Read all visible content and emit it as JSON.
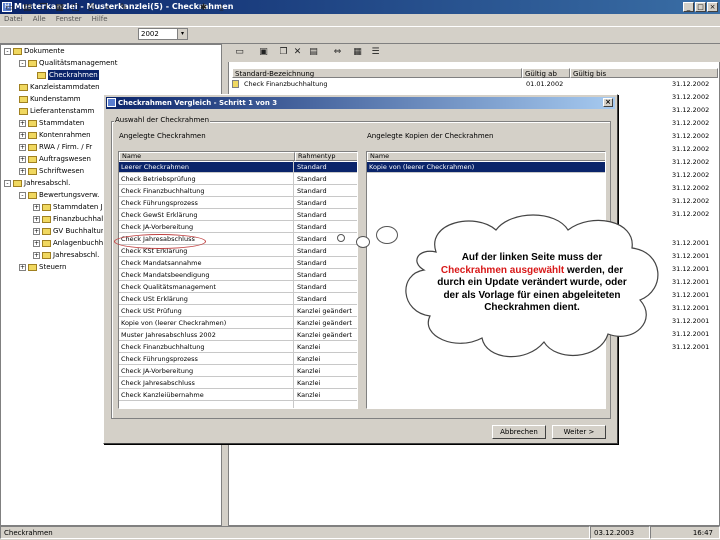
{
  "window": {
    "title": "Musterkanzlei - Musterkanzlei(5) - Checkrahmen",
    "app_icon": "app-icon",
    "controls": [
      "_",
      "□",
      "×"
    ]
  },
  "menu": [
    "Datei",
    "Alle",
    "Fenster",
    "Hilfe"
  ],
  "toolbar": {
    "year": "2002",
    "dropdown_glyph": "▾"
  },
  "tree": [
    {
      "label": "Dokumente",
      "expander": "-"
    },
    {
      "label": "Qualitätsmanagement",
      "expander": "-"
    },
    {
      "label": "Checkrahmen",
      "selected": true
    },
    {
      "label": "Kanzleistammdaten"
    },
    {
      "label": "Kundenstamm"
    },
    {
      "label": "Lieferantenstamm"
    },
    {
      "label": "Stammdaten",
      "expander": "+"
    },
    {
      "label": "Kontenrahmen",
      "expander": "+"
    },
    {
      "label": "RWA / Firm. / Fr",
      "expander": "+"
    },
    {
      "label": "Auftragswesen",
      "expander": "+"
    },
    {
      "label": "Schriftwesen",
      "expander": "+"
    },
    {
      "label": "Jahresabschl.",
      "expander": "-"
    },
    {
      "label": "Bewertungsverw.",
      "expander": "-"
    },
    {
      "label": "Stammdaten J.",
      "expander": "+"
    },
    {
      "label": "Finanzbuchhaltung",
      "expander": "+"
    },
    {
      "label": "GV Buchhaltung",
      "expander": "+"
    },
    {
      "label": "Anlagenbuchhaltung",
      "expander": "+"
    },
    {
      "label": "Jahresabschl.",
      "expander": "+"
    },
    {
      "label": "Steuern",
      "expander": "+"
    }
  ],
  "grid": {
    "columns": [
      "Standard-Bezeichnung",
      "Gültig ab",
      "Gültig bis"
    ],
    "first_row": {
      "name": "Check Finanzbuchhaltung",
      "from": "01.01.2002"
    },
    "dates": [
      "31.12.2002",
      "31.12.2002",
      "31.12.2002",
      "31.12.2002",
      "31.12.2002",
      "31.12.2002",
      "31.12.2002",
      "31.12.2002",
      "31.12.2002",
      "31.12.2002",
      "31.12.2002",
      "31.12.2001",
      "31.12.2001",
      "31.12.2001",
      "31.12.2001",
      "31.12.2001",
      "31.12.2001",
      "31.12.2001",
      "31.12.2001",
      "31.12.2001"
    ]
  },
  "status": {
    "left": "Checkrahmen",
    "date": "03.12.2003",
    "time": "16:47"
  },
  "dialog": {
    "title": "Checkrahmen Vergleich - Schritt 1 von 3",
    "close": "×",
    "group_label": "Auswahl der Checkrahmen",
    "left_label": "Angelegte Checkrahmen",
    "right_label": "Angelegte Kopien der Checkrahmen",
    "col_name": "Name",
    "col_type": "Rahmentyp",
    "left_rows": [
      {
        "name": "Leerer Checkrahmen",
        "type": "Standard",
        "selected": true
      },
      {
        "name": "Check Betriebsprüfung",
        "type": "Standard"
      },
      {
        "name": "Check Finanzbuchhaltung",
        "type": "Standard"
      },
      {
        "name": "Check Führungsprozess",
        "type": "Standard"
      },
      {
        "name": "Check GewSt Erklärung",
        "type": "Standard"
      },
      {
        "name": "Check JA-Vorbereitung",
        "type": "Standard"
      },
      {
        "name": "Check Jahresabschluss",
        "type": "Standard"
      },
      {
        "name": "Check KSt Erklärung",
        "type": "Standard"
      },
      {
        "name": "Check Mandatsannahme",
        "type": "Standard"
      },
      {
        "name": "Check Mandatsbeendigung",
        "type": "Standard"
      },
      {
        "name": "Check Qualitätsmanagement",
        "type": "Standard"
      },
      {
        "name": "Check USt Erklärung",
        "type": "Standard"
      },
      {
        "name": "Check USt Prüfung",
        "type": "Kanzlei geändert"
      },
      {
        "name": "Kopie von (leerer Checkrahmen)",
        "type": "Kanzlei geändert"
      },
      {
        "name": "Muster Jahresabschluss 2002",
        "type": "Kanzlei geändert"
      },
      {
        "name": "Check Finanzbuchhaltung",
        "type": "Kanzlei"
      },
      {
        "name": "Check Führungsprozess",
        "type": "Kanzlei"
      },
      {
        "name": "Check JA-Vorbereitung",
        "type": "Kanzlei"
      },
      {
        "name": "Check Jahresabschluss",
        "type": "Kanzlei"
      },
      {
        "name": "Check Kanzleiübernahme",
        "type": "Kanzlei"
      }
    ],
    "right_rows": [
      {
        "name": "Kopie von (leerer Checkrahmen)",
        "selected": true
      }
    ],
    "back_button": "Abbrechen",
    "next_button": "Weiter >"
  },
  "callout": {
    "text_before": "Auf der linken Seite muss der ",
    "highlight": "Checkrahmen ausgewählt",
    "text_after": " werden, der durch ein Update verändert wurde, oder der als Vorlage für einen abgeleiteten Checkrahmen dient."
  }
}
